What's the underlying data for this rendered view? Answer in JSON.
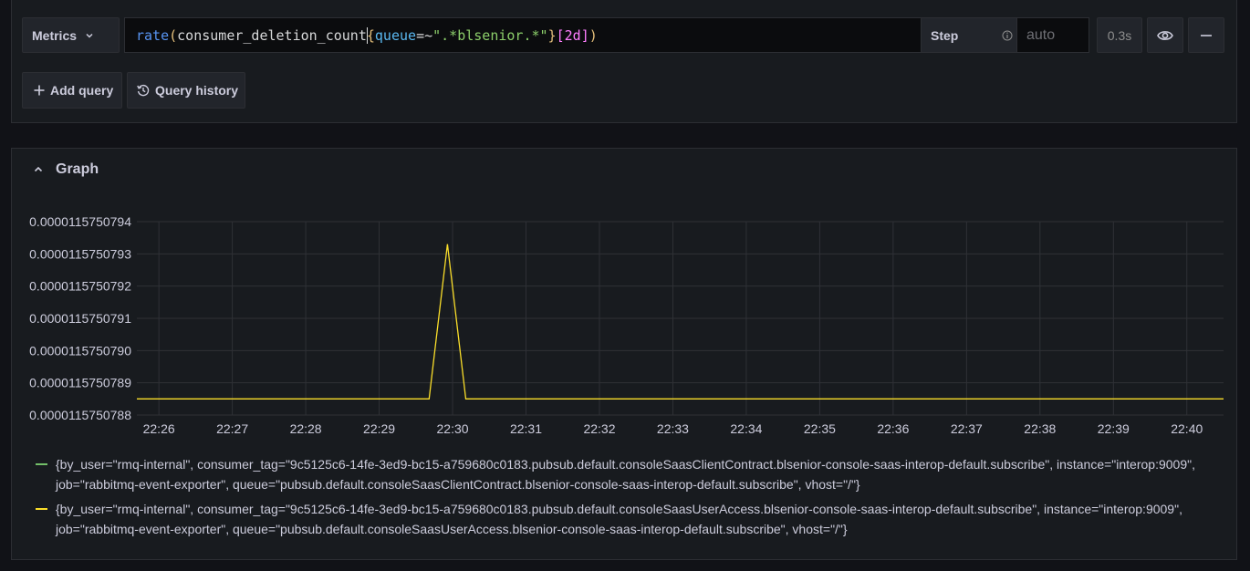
{
  "query_editor": {
    "metrics_label": "Metrics",
    "query_tokens": [
      {
        "text": "rate",
        "cls": "tok-fn"
      },
      {
        "text": "(",
        "cls": "tok-paren"
      },
      {
        "text": "consumer_deletion_count",
        "cls": "tok-metric"
      },
      {
        "text": "{",
        "cls": "tok-brace"
      },
      {
        "text": "queue",
        "cls": "tok-label"
      },
      {
        "text": "=~",
        "cls": "tok-op"
      },
      {
        "text": "\".*blsenior.*\"",
        "cls": "tok-str"
      },
      {
        "text": "}",
        "cls": "tok-brace"
      },
      {
        "text": "[",
        "cls": "tok-bracket"
      },
      {
        "text": "2d",
        "cls": "tok-dur"
      },
      {
        "text": "]",
        "cls": "tok-bracket"
      },
      {
        "text": ")",
        "cls": "tok-paren"
      }
    ],
    "step_label": "Step",
    "step_placeholder": "auto",
    "query_time": "0.3s",
    "add_query_label": "Add query",
    "query_history_label": "Query history"
  },
  "graph": {
    "title": "Graph",
    "legend": [
      {
        "color": "#73bf69",
        "text": "{by_user=\"rmq-internal\", consumer_tag=\"9c5125c6-14fe-3ed9-bc15-a759680c0183.pubsub.default.consoleSaasClientContract.blsenior-console-saas-interop-default.subscribe\", instance=\"interop:9009\", job=\"rabbitmq-event-exporter\", queue=\"pubsub.default.consoleSaasClientContract.blsenior-console-saas-interop-default.subscribe\", vhost=\"/\"}"
      },
      {
        "color": "#fade2a",
        "text": "{by_user=\"rmq-internal\", consumer_tag=\"9c5125c6-14fe-3ed9-bc15-a759680c0183.pubsub.default.consoleSaasUserAccess.blsenior-console-saas-interop-default.subscribe\", instance=\"interop:9009\", job=\"rabbitmq-event-exporter\", queue=\"pubsub.default.consoleSaasUserAccess.blsenior-console-saas-interop-default.subscribe\", vhost=\"/\"}"
      }
    ]
  },
  "chart_data": {
    "type": "line",
    "x_ticks": [
      "22:26",
      "22:27",
      "22:28",
      "22:29",
      "22:30",
      "22:31",
      "22:32",
      "22:33",
      "22:34",
      "22:35",
      "22:36",
      "22:37",
      "22:38",
      "22:39",
      "22:40"
    ],
    "y_ticks": [
      "0.0000115750788",
      "0.0000115750789",
      "0.0000115750790",
      "0.0000115750791",
      "0.0000115750792",
      "0.0000115750793",
      "0.0000115750794"
    ],
    "ylim": [
      1.15750788e-05,
      1.15750794e-05
    ],
    "xlim_minutes": [
      25.7,
      40.5
    ],
    "grid": true,
    "series": [
      {
        "color": "#fade2a",
        "points": [
          [
            25.7,
            1.157507885e-05
          ],
          [
            29.68,
            1.157507885e-05
          ],
          [
            29.93,
            1.157507933e-05
          ],
          [
            30.18,
            1.157507885e-05
          ],
          [
            40.5,
            1.157507885e-05
          ]
        ]
      }
    ]
  }
}
